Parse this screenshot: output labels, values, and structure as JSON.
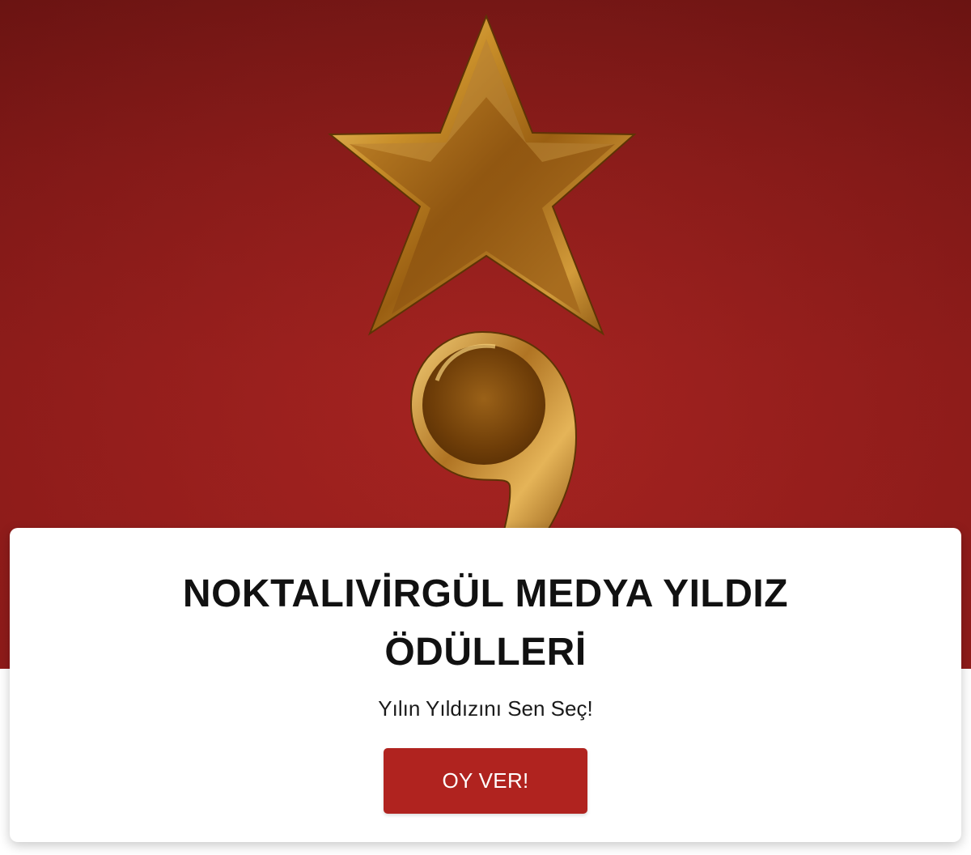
{
  "hero": {
    "image": "gold-star-semicolon-trophy",
    "background_color": "#9c211f"
  },
  "card": {
    "title": "NOKTALIVİRGÜL MEDYA YILDIZ ÖDÜLLERİ",
    "subtitle": "Yılın Yıldızını Sen Seç!",
    "vote_button_label": "OY VER!",
    "button_color": "#b0231f"
  }
}
